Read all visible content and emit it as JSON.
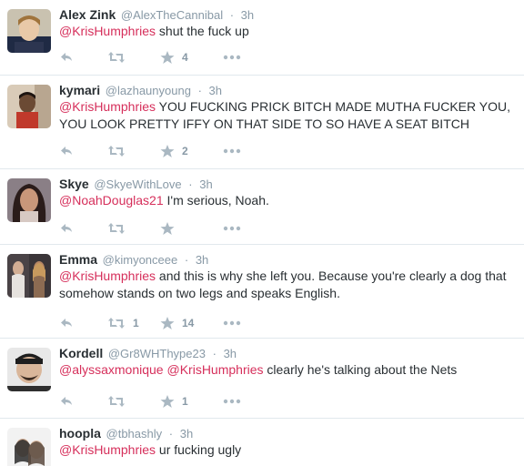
{
  "colors": {
    "mention": "#d62f5b",
    "meta": "#8899a6",
    "icon": "#aab8c2",
    "divider": "#e1e8ed"
  },
  "icons": {
    "reply": "reply-icon",
    "retweet": "retweet-icon",
    "favorite": "star-icon",
    "more": "more-dots-icon"
  },
  "tweets": [
    {
      "name": "Alex Zink",
      "handle": "@AlexTheCannibal",
      "sep": "·",
      "time": "3h",
      "mention1": "@KrisHumphries",
      "mention2": "",
      "text": " shut the fuck up",
      "retweets": "",
      "favorites": "4"
    },
    {
      "name": "kymari",
      "handle": "@lazhaunyoung",
      "sep": "·",
      "time": "3h",
      "mention1": "@KrisHumphries",
      "mention2": "",
      "text": " YOU FUCKING PRICK BITCH MADE MUTHA FUCKER YOU, YOU LOOK PRETTY IFFY ON THAT SIDE TO SO HAVE A SEAT BITCH",
      "retweets": "",
      "favorites": "2"
    },
    {
      "name": "Skye",
      "handle": "@SkyeWithLove",
      "sep": "·",
      "time": "3h",
      "mention1": "@NoahDouglas21",
      "mention2": "",
      "text": " I'm serious, Noah.",
      "retweets": "",
      "favorites": ""
    },
    {
      "name": "Emma",
      "handle": "@kimyonceee",
      "sep": "·",
      "time": "3h",
      "mention1": "@KrisHumphries",
      "mention2": "",
      "text": " and this is why she left you. Because you're clearly a dog that somehow stands on two legs and speaks English.",
      "retweets": "1",
      "favorites": "14"
    },
    {
      "name": "Kordell",
      "handle": "@Gr8WHThype23",
      "sep": "·",
      "time": "3h",
      "mention1": "@alyssaxmonique",
      "mention2": "@KrisHumphries",
      "text": " clearly he's talking about the Nets",
      "retweets": "",
      "favorites": "1"
    },
    {
      "name": "hoopla",
      "handle": "@tbhashly",
      "sep": "·",
      "time": "3h",
      "mention1": "@KrisHumphries",
      "mention2": "",
      "text": " ur fucking ugly",
      "retweets": "",
      "favorites": ""
    }
  ]
}
